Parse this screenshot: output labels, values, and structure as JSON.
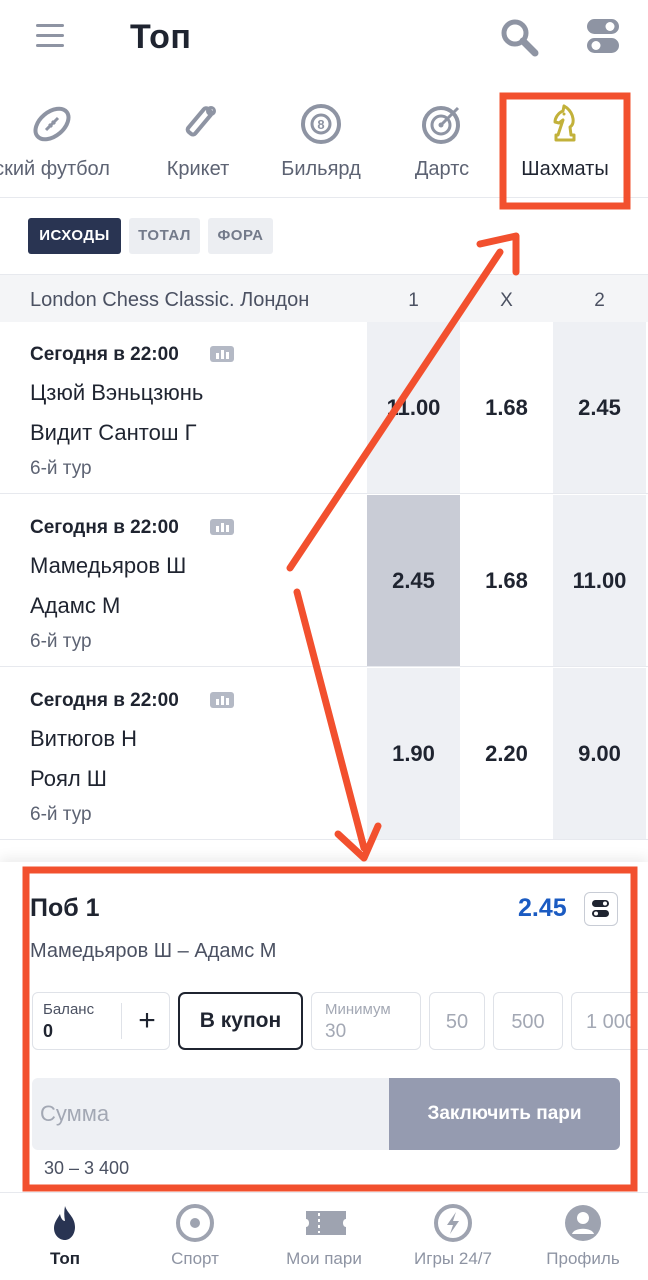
{
  "header": {
    "title": "Топ",
    "menu_icon": "hamburger-menu-icon",
    "search_icon": "search-icon",
    "settings_icon": "toggle-settings-icon"
  },
  "sports": [
    {
      "label": "ский футбол",
      "icon": "american-football-icon"
    },
    {
      "label": "Крикет",
      "icon": "cricket-bat-icon"
    },
    {
      "label": "Бильярд",
      "icon": "billiard-ball-icon"
    },
    {
      "label": "Дартс",
      "icon": "darts-target-icon"
    },
    {
      "label": "Шахматы",
      "icon": "chess-knight-icon",
      "active": true
    }
  ],
  "market_tabs": [
    {
      "label": "ИСХОДЫ",
      "active": true
    },
    {
      "label": "ТОТАЛ"
    },
    {
      "label": "ФОРА"
    }
  ],
  "table_header": {
    "league": "London Chess Classic. Лондон",
    "col1": "1",
    "colx": "X",
    "col2": "2"
  },
  "matches": [
    {
      "time": "Сегодня в 22:00",
      "team1": "Цзюй Вэньцзюнь",
      "team2": "Видит Сантош Г",
      "round": "6-й тур",
      "odd1": "11.00",
      "oddx": "1.68",
      "odd2": "2.45"
    },
    {
      "time": "Сегодня в 22:00",
      "team1": "Мамедьяров Ш",
      "team2": "Адамс М",
      "round": "6-й тур",
      "odd1": "2.45",
      "oddx": "1.68",
      "odd2": "11.00",
      "selected": "odd1"
    },
    {
      "time": "Сегодня в 22:00",
      "team1": "Витюгов Н",
      "team2": "Роял Ш",
      "round": "6-й тур",
      "odd1": "1.90",
      "oddx": "2.20",
      "odd2": "9.00"
    }
  ],
  "betslip": {
    "title": "Поб 1",
    "odd": "2.45",
    "match": "Мамедьяров Ш – Адамс М",
    "balance_label": "Баланс",
    "balance_value": "0",
    "plus": "+",
    "coupon_button": "В купон",
    "min_label": "Минимум",
    "min_value": "30",
    "quick_amounts": [
      "50",
      "500",
      "1 000"
    ],
    "sum_placeholder": "Сумма",
    "submit_button": "Заключить пари",
    "range": "30 – 3 400"
  },
  "bottom_nav": [
    {
      "label": "Топ",
      "icon": "flame-icon",
      "active": true
    },
    {
      "label": "Спорт",
      "icon": "sport-target-icon"
    },
    {
      "label": "Мои пари",
      "icon": "ticket-icon"
    },
    {
      "label": "Игры 24/7",
      "icon": "lightning-icon"
    },
    {
      "label": "Профиль",
      "icon": "profile-icon"
    }
  ],
  "colors": {
    "accent_navy": "#293452",
    "odd_blue": "#1b5bc2",
    "annotation_red": "#f2502e",
    "chess_gold": "#c2b13a"
  }
}
